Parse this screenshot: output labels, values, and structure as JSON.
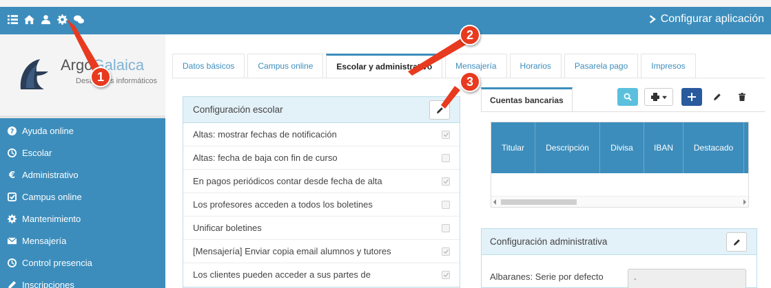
{
  "topbar": {
    "icons": [
      "list-icon",
      "home-icon",
      "user-icon",
      "gear-icon",
      "chat-icon"
    ],
    "config_label": "Configurar aplicación"
  },
  "brand": {
    "name_part1": "Argo",
    "name_part2": "Galaica",
    "subtitle": "Desarrollos informáticos"
  },
  "sidebar": {
    "items": [
      {
        "label": "Ayuda online",
        "icon": "question-icon"
      },
      {
        "label": "Escolar",
        "icon": "clock-icon"
      },
      {
        "label": "Administrativo",
        "icon": "euro-icon"
      },
      {
        "label": "Campus online",
        "icon": "check-square-icon"
      },
      {
        "label": "Mantenimiento",
        "icon": "gear-icon"
      },
      {
        "label": "Mensajería",
        "icon": "envelope-icon"
      },
      {
        "label": "Control presencia",
        "icon": "clock-icon"
      },
      {
        "label": "Inscripciones",
        "icon": "pencil-icon"
      }
    ]
  },
  "tabs": [
    {
      "label": "Datos básicos",
      "active": false
    },
    {
      "label": "Campus online",
      "active": false
    },
    {
      "label": "Escolar y administrativo",
      "active": true
    },
    {
      "label": "Mensajería",
      "active": false
    },
    {
      "label": "Horarios",
      "active": false
    },
    {
      "label": "Pasarela pago",
      "active": false
    },
    {
      "label": "Impresos",
      "active": false
    }
  ],
  "escolar_panel": {
    "title": "Configuración escolar",
    "rows": [
      {
        "label": "Altas: mostrar fechas de notificación",
        "checked": true
      },
      {
        "label": "Altas: fecha de baja con fin de curso",
        "checked": false
      },
      {
        "label": "En pagos periódicos contar desde fecha de alta",
        "checked": true
      },
      {
        "label": "Los profesores acceden a todos los boletines",
        "checked": false
      },
      {
        "label": "Unificar boletines",
        "checked": false
      },
      {
        "label": "[Mensajería] Enviar copia email alumnos y tutores",
        "checked": true
      },
      {
        "label": "Los clientes pueden acceder a sus partes de",
        "checked": true
      }
    ]
  },
  "cuentas": {
    "tab_label": "Cuentas bancarias",
    "columns": [
      "Titular",
      "Descripción",
      "Divisa",
      "IBAN",
      "Destacado"
    ],
    "toolbar": [
      "search-icon",
      "print-icon",
      "add-icon",
      "edit-icon",
      "delete-icon"
    ]
  },
  "admin_panel": {
    "title": "Configuración administrativa",
    "field_label": "Albaranes: Serie por defecto",
    "field_value": "-"
  },
  "badges": [
    "1",
    "2",
    "3"
  ],
  "colors": {
    "primary": "#3c8dbc",
    "panel_head": "#e3f1f8",
    "badge": "#e83a1f",
    "add_button": "#2a5a9e",
    "search_button": "#5bc0de"
  }
}
